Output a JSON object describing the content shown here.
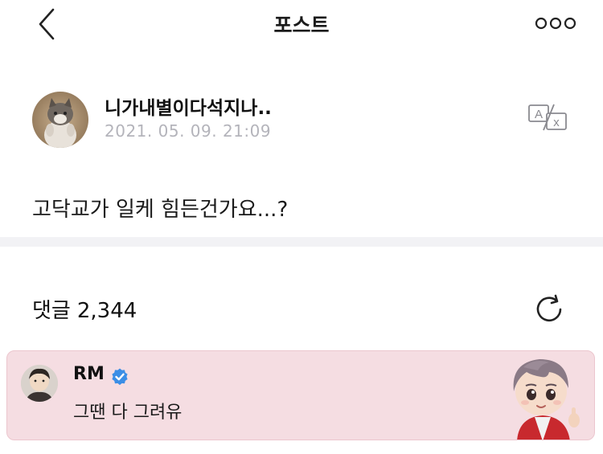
{
  "header": {
    "title": "포스트",
    "back_icon": "chevron-left-icon",
    "more_icon": "more-dots-icon"
  },
  "post": {
    "author": "니가내별이다석지나..",
    "timestamp": "2021. 05. 09. 21:09",
    "body": "고닥교가 일케 힘든건가요...?",
    "translate_icon": "translate-icon"
  },
  "comments": {
    "label": "댓글",
    "count": "2,344",
    "refresh_icon": "refresh-icon",
    "highlighted": {
      "author": "RM",
      "verified_icon": "verified-badge-icon",
      "text": "그땐 다 그려유",
      "background_color": "#f5dde2"
    }
  },
  "colors": {
    "verified": "#3b8ee6",
    "timestamp": "#b4b4bb",
    "divider": "#f2f2f5"
  }
}
